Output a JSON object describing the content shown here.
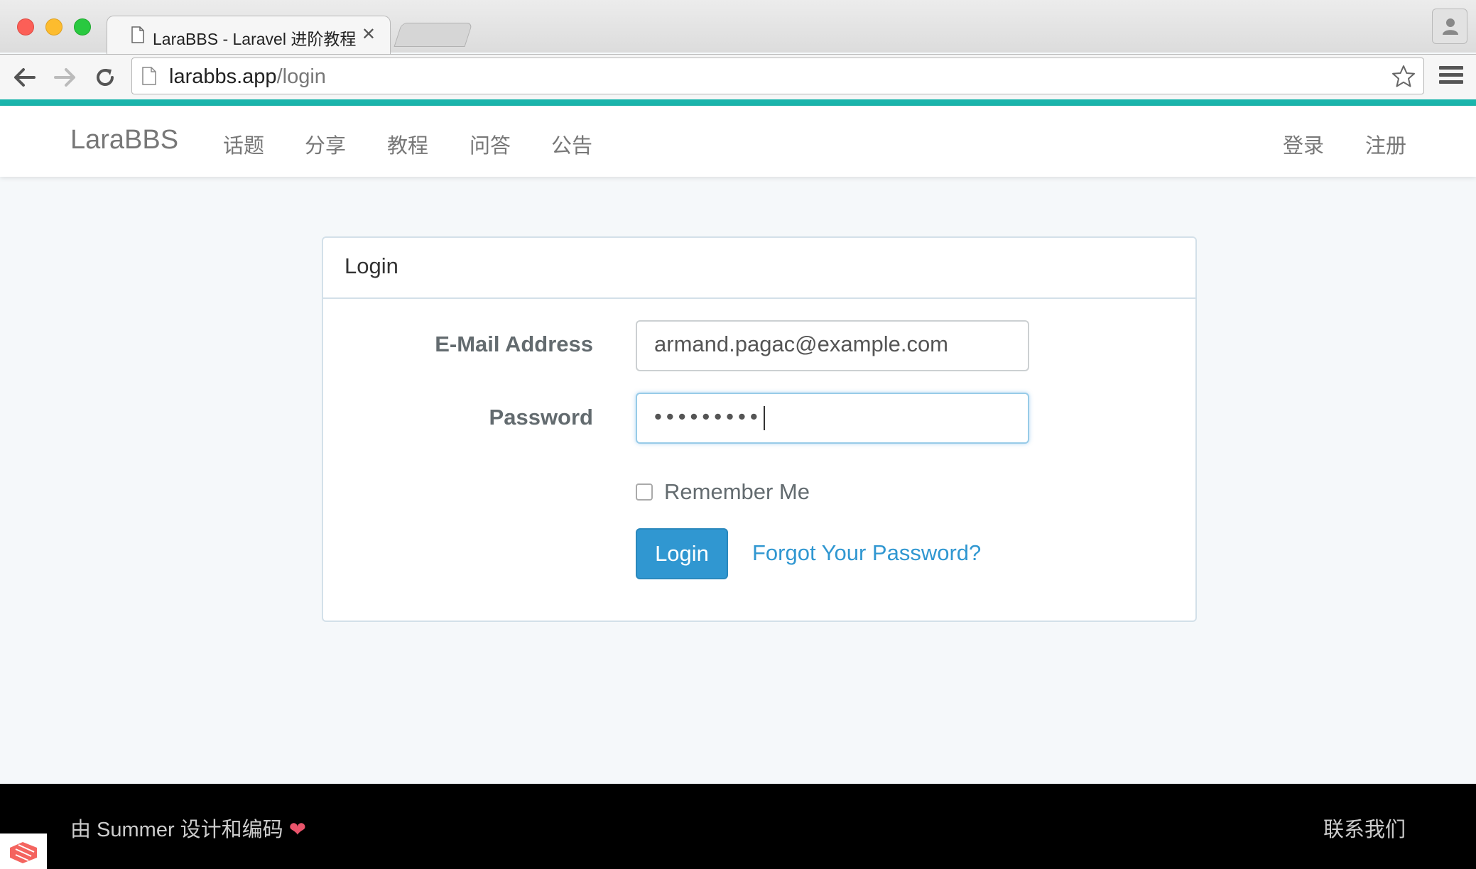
{
  "browser": {
    "tab_title": "LaraBBS - Laravel 进阶教程",
    "tab_close": "✕",
    "url_host": "larabbs.app",
    "url_path": "/login",
    "accent_color": "#1bb5ac"
  },
  "navbar": {
    "brand": "LaraBBS",
    "links": [
      "话题",
      "分享",
      "教程",
      "问答",
      "公告"
    ],
    "auth": {
      "login": "登录",
      "register": "注册"
    }
  },
  "login_card": {
    "title": "Login",
    "email_label": "E-Mail Address",
    "email_value": "armand.pagac@example.com",
    "password_label": "Password",
    "password_value": "•••••••••",
    "remember_label": "Remember Me",
    "remember_checked": false,
    "submit_label": "Login",
    "forgot_link": "Forgot Your Password?",
    "primary_color": "#3097d1"
  },
  "footer": {
    "credit_text": "由 Summer 设计和编码",
    "heart": "❤",
    "contact": "联系我们"
  },
  "icons": [
    "page-icon",
    "back-arrow-icon",
    "forward-arrow-icon",
    "reload-icon",
    "star-icon",
    "menu-icon",
    "profile-icon",
    "laravel-logo-icon",
    "heart-icon"
  ]
}
